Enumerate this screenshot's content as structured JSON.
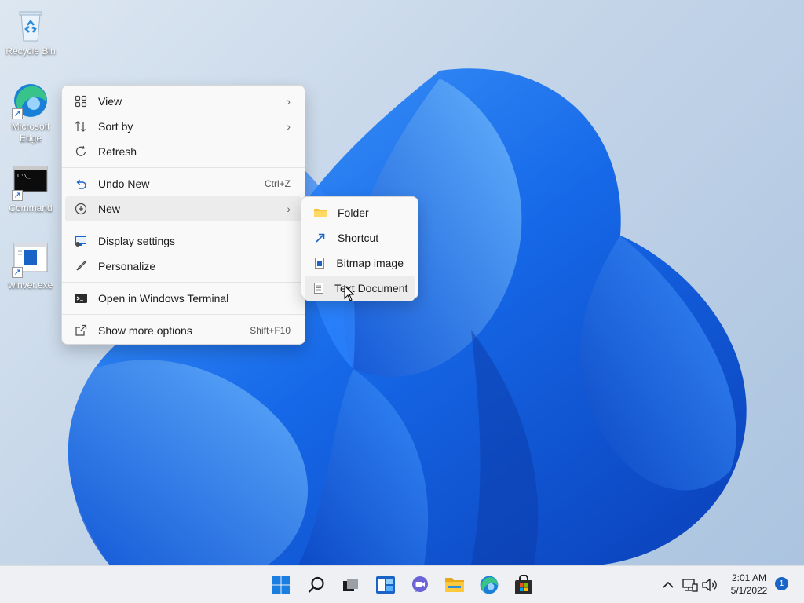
{
  "desktop": {
    "icons": [
      {
        "label": "Recycle Bin"
      },
      {
        "label": "Microsoft Edge"
      },
      {
        "label": "Command"
      },
      {
        "label": "winver.exe"
      }
    ]
  },
  "context_menu": {
    "view": "View",
    "sort_by": "Sort by",
    "refresh": "Refresh",
    "undo_new": "Undo New",
    "undo_shortcut": "Ctrl+Z",
    "new": "New",
    "display_settings": "Display settings",
    "personalize": "Personalize",
    "open_terminal": "Open in Windows Terminal",
    "show_more": "Show more options",
    "show_more_shortcut": "Shift+F10"
  },
  "submenu_new": {
    "items": [
      "Folder",
      "Shortcut",
      "Bitmap image",
      "Text Document"
    ]
  },
  "taskbar": {
    "time": "2:01 AM",
    "date": "5/1/2022",
    "notification_count": "1"
  },
  "colors": {
    "accent": "#1a64c8",
    "wallpaper_blue": "#1e6fe8"
  }
}
